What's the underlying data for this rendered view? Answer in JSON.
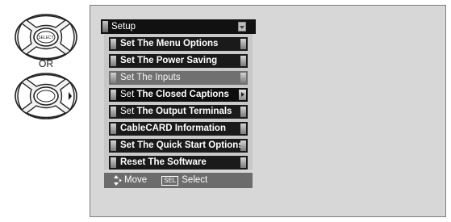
{
  "remote": {
    "center_button_label": "SELECT",
    "or_label": "OR"
  },
  "menu": {
    "title": "Setup",
    "items": [
      {
        "label": "Set The Menu Options"
      },
      {
        "label": "Set The Power Saving"
      },
      {
        "label": "Set The Inputs"
      },
      {
        "prefix": "Set ",
        "label": "The Closed Captions"
      },
      {
        "prefix": "Set ",
        "label": "The Output Terminals"
      },
      {
        "label": "CableCARD Information"
      },
      {
        "label": "Set The Quick Start Options"
      },
      {
        "label": "Reset The Software"
      }
    ],
    "footer": {
      "move_label": "Move",
      "sel_key": "SEL",
      "select_label": "Select"
    }
  }
}
